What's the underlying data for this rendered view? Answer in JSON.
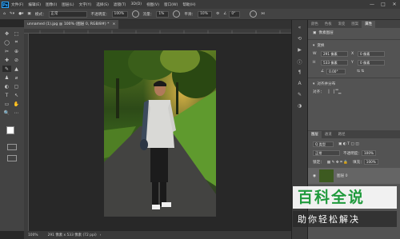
{
  "menubar": {
    "logo": "Ps",
    "items": [
      "文件(F)",
      "编辑(E)",
      "图像(I)",
      "图层(L)",
      "文字(Y)",
      "选择(S)",
      "滤镜(T)",
      "3D(D)",
      "视图(V)",
      "窗口(W)",
      "帮助(H)"
    ],
    "minimize": "—",
    "maximize": "□",
    "close": "✕"
  },
  "options": {
    "mode_label": "模式：",
    "mode_value": "正常",
    "opacity_label": "不透明度：",
    "opacity_value": "100%",
    "flow_label": "流量：",
    "flow_value": "1%",
    "smooth_label": "平滑：",
    "smooth_value": "10%",
    "angle_value": "0°"
  },
  "document": {
    "tab_title": "unnamed (1).jpg @ 100% (图层 0, RGB/8#) *",
    "tab_close": "×",
    "zoom": "100%",
    "doc_size": "291 像素 x 533 像素 (72 ppi)"
  },
  "tools": [
    "✥",
    "⬚",
    "◯",
    "⌗",
    "✂",
    "⊕",
    "✚",
    "⊘",
    "✎",
    "▲",
    "♟",
    "⌀",
    "◐",
    "▢",
    "T",
    "↖",
    "▭",
    "✋",
    "🔍",
    "⋯"
  ],
  "panel": {
    "tabs": [
      "颜色",
      "色板",
      "渐变",
      "图案",
      "属性"
    ],
    "doc_section": "像素图层",
    "transform_label": "变换",
    "w_value": "291 像素",
    "h_value": "533 像素",
    "x_value": "0 像素",
    "y_value": "0 像素",
    "angle_value": "0.00°",
    "align_label": "对齐并分布",
    "align_sub": "对齐：",
    "layer_tabs": [
      "图层",
      "通道",
      "路径"
    ],
    "kind_label": "Q 类型",
    "blend_mode": "正常",
    "opacity_label": "不透明度：",
    "opacity_value": "100%",
    "lock_label": "锁定：",
    "fill_label": "填充：",
    "fill_value": "100%",
    "layer_name": "图层 0"
  },
  "watermark": {
    "title": "百科全说",
    "subtitle": "助你轻松解决"
  },
  "colors": {
    "accent": "#31a8ff",
    "watermark_green": "#1f9a3c",
    "foreground": "#ffffff",
    "background": "#000000"
  }
}
